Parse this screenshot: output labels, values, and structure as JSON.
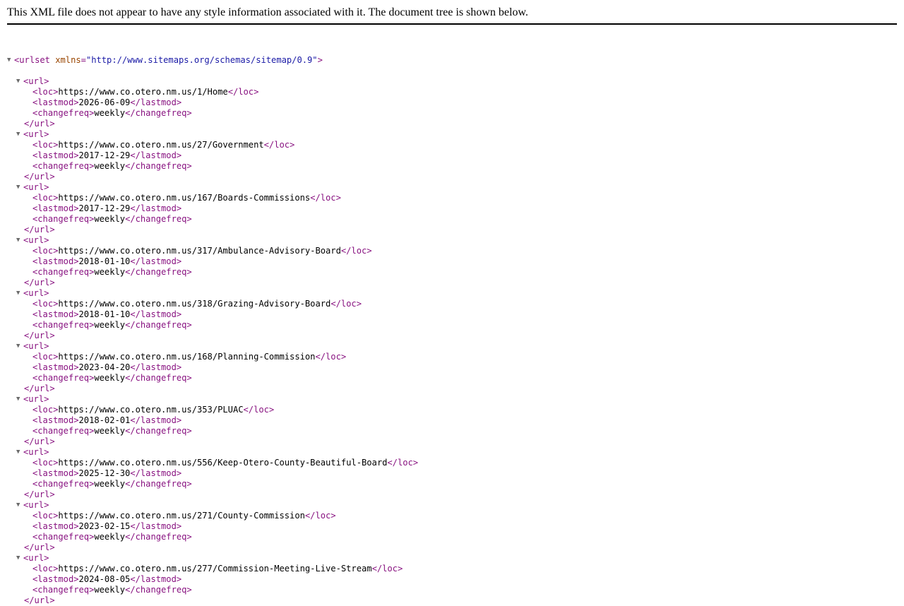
{
  "header": {
    "message": "This XML file does not appear to have any style information associated with it. The document tree is shown below."
  },
  "root": {
    "tag": "urlset",
    "attr_name": "xmlns",
    "attr_value": "\"http://www.sitemaps.org/schemas/sitemap/0.9\"",
    "toggle_icon": "▼"
  },
  "urls": [
    {
      "loc": "https://www.co.otero.nm.us/1/Home",
      "lastmod": "2026-06-09",
      "changefreq": "weekly"
    },
    {
      "loc": "https://www.co.otero.nm.us/27/Government",
      "lastmod": "2017-12-29",
      "changefreq": "weekly"
    },
    {
      "loc": "https://www.co.otero.nm.us/167/Boards-Commissions",
      "lastmod": "2017-12-29",
      "changefreq": "weekly"
    },
    {
      "loc": "https://www.co.otero.nm.us/317/Ambulance-Advisory-Board",
      "lastmod": "2018-01-10",
      "changefreq": "weekly"
    },
    {
      "loc": "https://www.co.otero.nm.us/318/Grazing-Advisory-Board",
      "lastmod": "2018-01-10",
      "changefreq": "weekly"
    },
    {
      "loc": "https://www.co.otero.nm.us/168/Planning-Commission",
      "lastmod": "2023-04-20",
      "changefreq": "weekly"
    },
    {
      "loc": "https://www.co.otero.nm.us/353/PLUAC",
      "lastmod": "2018-02-01",
      "changefreq": "weekly"
    },
    {
      "loc": "https://www.co.otero.nm.us/556/Keep-Otero-County-Beautiful-Board",
      "lastmod": "2025-12-30",
      "changefreq": "weekly"
    },
    {
      "loc": "https://www.co.otero.nm.us/271/County-Commission",
      "lastmod": "2023-02-15",
      "changefreq": "weekly"
    },
    {
      "loc": "https://www.co.otero.nm.us/277/Commission-Meeting-Live-Stream",
      "lastmod": "2024-08-05",
      "changefreq": "weekly"
    }
  ],
  "colors": {
    "tag": "#881280",
    "attribute_name": "#994500",
    "attribute_value": "#1a1aa6",
    "text": "#000000",
    "toggle": "#6a6a6a"
  }
}
